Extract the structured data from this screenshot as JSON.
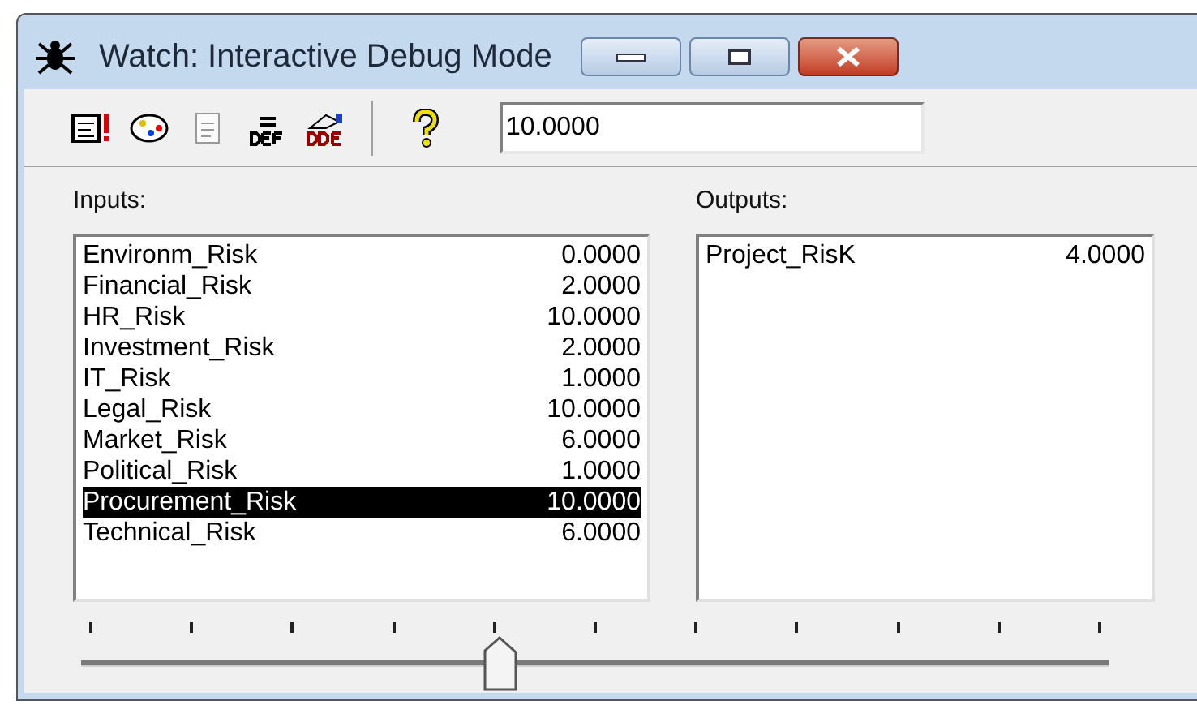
{
  "window": {
    "title": "Watch: Interactive Debug Mode"
  },
  "toolbar": {
    "value_field": {
      "value": "10.0000"
    }
  },
  "inputs": {
    "label": "Inputs:",
    "items": [
      {
        "name": "Environm_Risk",
        "value": "0.0000",
        "selected": false
      },
      {
        "name": "Financial_Risk",
        "value": "2.0000",
        "selected": false
      },
      {
        "name": "HR_Risk",
        "value": "10.0000",
        "selected": false
      },
      {
        "name": "Investment_Risk",
        "value": "2.0000",
        "selected": false
      },
      {
        "name": "IT_Risk",
        "value": "1.0000",
        "selected": false
      },
      {
        "name": "Legal_Risk",
        "value": "10.0000",
        "selected": false
      },
      {
        "name": "Market_Risk",
        "value": "6.0000",
        "selected": false
      },
      {
        "name": "Political_Risk",
        "value": "1.0000",
        "selected": false
      },
      {
        "name": "Procurement_Risk",
        "value": "10.0000",
        "selected": true
      },
      {
        "name": "Technical_Risk",
        "value": "6.0000",
        "selected": false
      }
    ]
  },
  "outputs": {
    "label": "Outputs:",
    "items": [
      {
        "name": "Project_RisK",
        "value": "4.0000"
      }
    ]
  },
  "slider": {
    "level": 0.4
  }
}
